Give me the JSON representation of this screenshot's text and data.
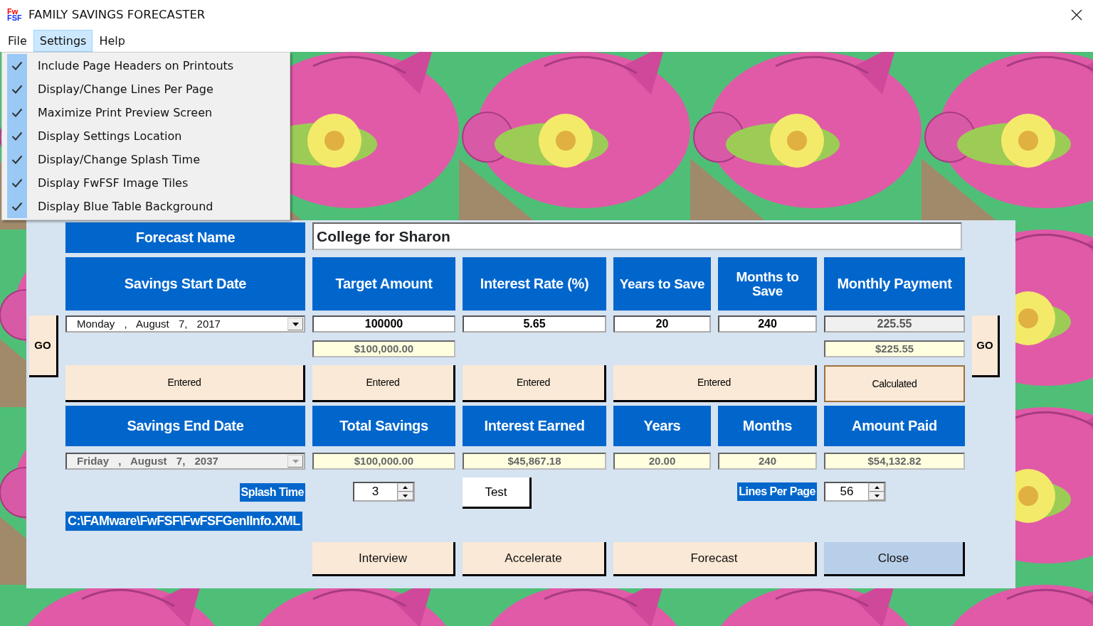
{
  "window": {
    "title": "FAMILY SAVINGS FORECASTER",
    "logo_top": "Fw",
    "logo_bottom": "FSF"
  },
  "menu": [
    {
      "label": "File",
      "selected": false
    },
    {
      "label": "Settings",
      "selected": true
    },
    {
      "label": "Help",
      "selected": false
    }
  ],
  "settings_menu": [
    {
      "label": "Include Page Headers on Printouts",
      "checked": true
    },
    {
      "label": "Display/Change Lines Per Page",
      "checked": true
    },
    {
      "label": "Maximize Print Preview Screen",
      "checked": true
    },
    {
      "label": "Display Settings Location",
      "checked": true
    },
    {
      "label": "Display/Change Splash Time",
      "checked": true
    },
    {
      "label": "Display FwFSF Image Tiles",
      "checked": true
    },
    {
      "label": "Display Blue Table Background",
      "checked": true
    }
  ],
  "forecast_name": {
    "label": "Forecast Name",
    "value": "College for Sharon"
  },
  "go_buttons": [
    "GO",
    "GO"
  ],
  "input_columns": [
    {
      "kind": "date",
      "header": "Savings Start Date",
      "value": "Monday , August 7, 2017",
      "status": "Entered",
      "calculated": false
    },
    {
      "kind": "number",
      "header": "Target Amount",
      "value": "100000",
      "formatted": "$100,000.00",
      "status": "Entered",
      "calculated": false
    },
    {
      "kind": "number",
      "header": "Interest Rate (%)",
      "value": "5.65",
      "status": "Entered",
      "calculated": false
    },
    {
      "kind": "number",
      "header": "Years to Save",
      "value": "20",
      "status": "Entered",
      "calculated": false
    },
    {
      "kind": "number",
      "header": "Months to Save",
      "value": "240",
      "calculated": false
    },
    {
      "kind": "number",
      "header": "Monthly Payment",
      "value": "225.55",
      "formatted": "$225.55",
      "status": "Calculated",
      "calculated": true
    }
  ],
  "result_columns": [
    {
      "kind": "date",
      "header": "Savings End Date",
      "value": "Friday , August 7, 2037"
    },
    {
      "kind": "number",
      "header": "Total Savings",
      "value": "$100,000.00"
    },
    {
      "kind": "number",
      "header": "Interest Earned",
      "value": "$45,867.18"
    },
    {
      "kind": "number",
      "header": "Years",
      "value": "20.00"
    },
    {
      "kind": "number",
      "header": "Months",
      "value": "240"
    },
    {
      "kind": "number",
      "header": "Amount Paid",
      "value": "$54,132.82"
    }
  ],
  "splash_time": {
    "label": "Splash Time",
    "value": "3"
  },
  "test_button": "Test",
  "lines_per_page": {
    "label": "Lines Per Page",
    "value": "56"
  },
  "settings_path": "C:\\FAMware\\FwFSF\\FwFSFGenlInfo.XML",
  "buttons": [
    {
      "label": "Interview",
      "kind": "normal"
    },
    {
      "label": "Accelerate",
      "kind": "normal"
    },
    {
      "label": "Forecast",
      "kind": "normal"
    },
    {
      "label": "Close",
      "kind": "default"
    }
  ]
}
